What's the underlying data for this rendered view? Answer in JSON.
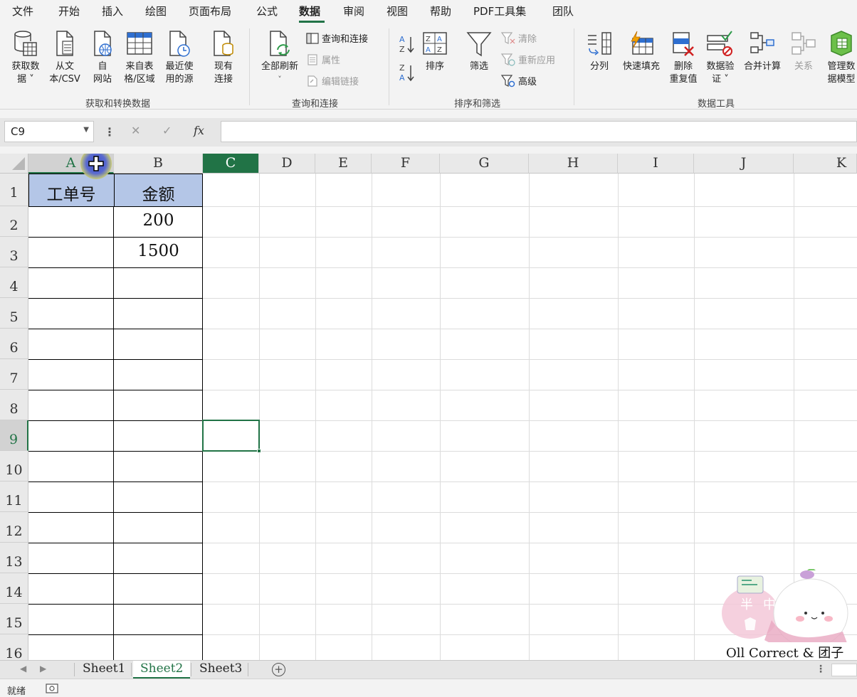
{
  "menu": {
    "tabs": [
      "文件",
      "开始",
      "插入",
      "绘图",
      "页面布局",
      "公式",
      "数据",
      "审阅",
      "视图",
      "帮助",
      "PDF工具集",
      "团队"
    ],
    "active": "数据"
  },
  "ribbon": {
    "get_transform": {
      "get_data": "获取数\n据 ˅",
      "from_text": "从文\n本/CSV",
      "from_web": "自\n网站",
      "from_table": "来自表\n格/区域",
      "recent_sources": "最近使\n用的源",
      "existing_conn": "现有\n连接",
      "group_label": "获取和转换数据"
    },
    "queries": {
      "refresh_all": "全部刷新",
      "queries_conn": "查询和连接",
      "properties": "属性",
      "edit_links": "编辑链接",
      "group_label": "查询和连接"
    },
    "sort_filter": {
      "sort": "排序",
      "filter": "筛选",
      "clear": "清除",
      "reapply": "重新应用",
      "advanced": "高级",
      "group_label": "排序和筛选"
    },
    "data_tools": {
      "text_to_cols": "分列",
      "flash_fill": "快速填充",
      "remove_dup": "删除\n重复值",
      "validation": "数据验\n证 ˅",
      "consolidate": "合并计算",
      "relationships": "关系",
      "manage_model": "管理数\n据模型",
      "group_label": "数据工具"
    }
  },
  "formula_bar": {
    "name_box": "C9",
    "fx": "fx",
    "value": ""
  },
  "grid": {
    "columns": [
      "A",
      "B",
      "C",
      "D",
      "E",
      "F",
      "G",
      "H",
      "I",
      "J",
      "K"
    ],
    "rows": [
      "1",
      "2",
      "3",
      "4",
      "5",
      "6",
      "7",
      "8",
      "9",
      "10",
      "11",
      "12",
      "13",
      "14",
      "15",
      "16"
    ],
    "active_cell": "C9",
    "cells": {
      "A1": "工单号",
      "B1": "金额",
      "B2": "200",
      "B3": "1500"
    }
  },
  "sheets": {
    "tabs": [
      "Sheet1",
      "Sheet2",
      "Sheet3"
    ],
    "active": "Sheet2"
  },
  "status": {
    "ready": "就绪"
  },
  "watermark": {
    "glyphs": [
      "半",
      "中"
    ],
    "caption": "Oll Correct & 团子"
  },
  "colors": {
    "accent": "#217346",
    "header_fill": "#b4c6e7"
  }
}
